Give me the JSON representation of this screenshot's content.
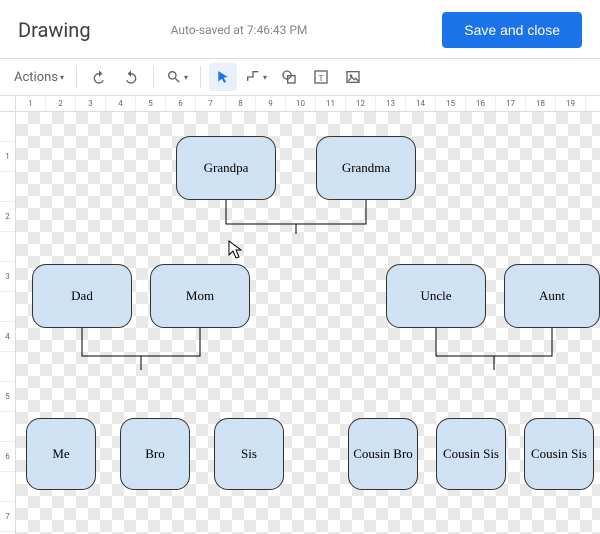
{
  "header": {
    "title": "Drawing",
    "autosave": "Auto-saved at 7:46:43 PM",
    "save_label": "Save and close"
  },
  "toolbar": {
    "actions_label": "Actions"
  },
  "ruler": {
    "h": [
      "1",
      "2",
      "3",
      "4",
      "5",
      "6",
      "7",
      "8",
      "9",
      "10",
      "11",
      "12",
      "13",
      "14",
      "15",
      "16",
      "17",
      "18",
      "19"
    ],
    "v": [
      "",
      "1",
      "",
      "2",
      "",
      "3",
      "",
      "4",
      "",
      "5",
      "",
      "6",
      "",
      "7"
    ]
  },
  "nodes": {
    "grandpa": "Grandpa",
    "grandma": "Grandma",
    "dad": "Dad",
    "mom": "Mom",
    "uncle": "Uncle",
    "aunt": "Aunt",
    "me": "Me",
    "bro": "Bro",
    "sis": "Sis",
    "cousin_bro": "Cousin Bro",
    "cousin_sis1": "Cousin Sis",
    "cousin_sis2": "Cousin Sis"
  },
  "colors": {
    "node_fill": "#cfe2f3",
    "accent": "#1a73e8"
  }
}
